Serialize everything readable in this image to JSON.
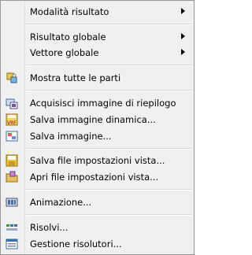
{
  "menu": {
    "items": [
      {
        "label": "Modalità risultato",
        "submenu": true
      },
      {
        "label": "Risultato globale",
        "submenu": true
      },
      {
        "label": "Vettore globale",
        "submenu": true
      },
      {
        "label": "Mostra tutte le parti",
        "icon": "show-parts-icon"
      },
      {
        "label": "Acquisisci immagine di riepilogo",
        "icon": "capture-summary-icon"
      },
      {
        "label": "Salva immagine dinamica...",
        "icon": "save-animated-image-icon"
      },
      {
        "label": "Salva immagine...",
        "icon": "save-image-icon"
      },
      {
        "label": "Salva file impostazioni vista...",
        "icon": "save-view-settings-icon"
      },
      {
        "label": "Apri file impostazioni vista...",
        "icon": "open-view-settings-icon"
      },
      {
        "label": "Animazione...",
        "icon": "animation-icon"
      },
      {
        "label": "Risolvi...",
        "icon": "solve-icon"
      },
      {
        "label": "Gestione risolutori...",
        "icon": "solver-manager-icon"
      }
    ]
  },
  "colors": {
    "menu_bg": "#f0f0f0",
    "border": "#979797",
    "separator": "#d7d7d7"
  }
}
